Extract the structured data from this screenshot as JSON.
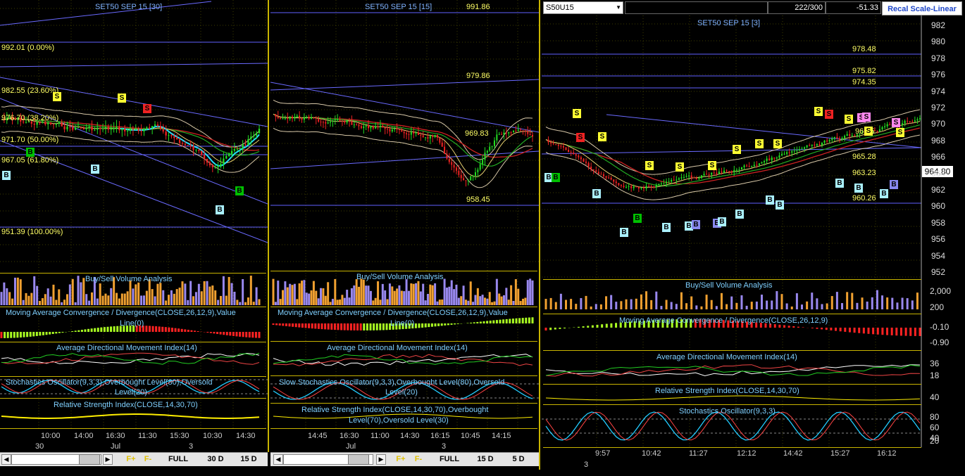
{
  "colors": {
    "bull": "#22dd22",
    "bear": "#ee2222",
    "accent": "#c8b400",
    "fib": "#ffff66",
    "indicator": "#7fd0ff",
    "header_link": "#1e46c8"
  },
  "left": {
    "title": "SET50 SEP 15  [30]",
    "fib_labels": [
      "992.01 (0.00%)",
      "982.55 (23.60%)",
      "976.70 (38.20%)",
      "971.70 (50.00%)",
      "967.05 (61.80%)",
      "951.39 (100.00%)"
    ],
    "indicators": [
      "Buy/Sell Volume Analysis",
      "Moving Average Convergence / Divergence(CLOSE,26,12,9),Value",
      "Line(0)",
      "Average Directional Movement Index(14)",
      "Stochastics Oscillator(9,3,3),Overbought Level(80),Oversold",
      "Level(20)",
      "Relative Strength Index(CLOSE,14,30,70)"
    ],
    "time_ticks": [
      "10:00",
      "14:00",
      "16:30",
      "11:30",
      "15:30",
      "10:30",
      "14:30"
    ],
    "date_ticks": [
      "30",
      "Jul",
      "3"
    ],
    "toolbar": {
      "f_plus": "F+",
      "f_minus": "F-",
      "full": "FULL",
      "d30": "30 D",
      "d15": "15 D"
    },
    "markers": [
      {
        "t": "S",
        "k": "s"
      },
      {
        "t": "S",
        "k": "s"
      },
      {
        "t": "S",
        "k": "sr"
      },
      {
        "t": "B",
        "k": "bg"
      },
      {
        "t": "B",
        "k": "b"
      },
      {
        "t": "B",
        "k": "b"
      },
      {
        "t": "B",
        "k": "bg"
      },
      {
        "t": "B",
        "k": "b"
      }
    ]
  },
  "mid": {
    "title": "SET50 SEP 15  [15]",
    "levels": [
      "991.86",
      "979.86",
      "969.83",
      "958.45"
    ],
    "indicators": [
      "Buy/Sell Volume Analysis",
      "Moving Average Convergence / Divergence(CLOSE,26,12,9),Value",
      "Line(0)",
      "Average Directional Movement Index(14)",
      "Slow Stochastics Oscillator(9,3,3),Overbought Level(80),Oversold",
      "Level(20)",
      "Relative Strength Index(CLOSE,14,30,70),Overbought",
      "Level(70),Oversold Level(30)"
    ],
    "time_ticks": [
      "14:45",
      "16:30",
      "11:00",
      "14:30",
      "16:15",
      "10:45",
      "14:15"
    ],
    "date_ticks": [
      "Jul",
      "3"
    ],
    "toolbar": {
      "f_plus": "F+",
      "f_minus": "F-",
      "full": "FULL",
      "d15": "15 D",
      "d5": "5 D"
    },
    "markers": [
      {
        "t": "S",
        "k": "sp"
      },
      {
        "t": "S",
        "k": "s"
      },
      {
        "t": "S",
        "k": "sr"
      },
      {
        "t": "S",
        "k": "s"
      },
      {
        "t": "S",
        "k": "sp"
      },
      {
        "t": "S",
        "k": "sr"
      },
      {
        "t": "S",
        "k": "s"
      },
      {
        "t": "S",
        "k": "s"
      },
      {
        "t": "S",
        "k": "s"
      },
      {
        "t": "S",
        "k": "s"
      },
      {
        "t": "S",
        "k": "sp"
      },
      {
        "t": "B",
        "k": "bv"
      },
      {
        "t": "B",
        "k": "b"
      },
      {
        "t": "B",
        "k": "bg"
      },
      {
        "t": "B",
        "k": "bv"
      },
      {
        "t": "B",
        "k": "b"
      },
      {
        "t": "B",
        "k": "b"
      },
      {
        "t": "B",
        "k": "b"
      },
      {
        "t": "B",
        "k": "b"
      },
      {
        "t": "B",
        "k": "bg"
      },
      {
        "t": "B",
        "k": "bv"
      }
    ]
  },
  "right": {
    "symbol": "S50U15",
    "count": "222/300",
    "change": "-51.33",
    "recal_label": "Recal Scale-Linear",
    "title": "SET50 SEP 15  [3]",
    "levels": [
      "978.48",
      "975.82",
      "974.35",
      "966.5",
      "965.28",
      "963.23",
      "960.26"
    ],
    "last_price": "964.80",
    "price_axis": [
      "982",
      "980",
      "978",
      "976",
      "974",
      "972",
      "970",
      "968",
      "966",
      "964",
      "962",
      "960",
      "958",
      "956",
      "954",
      "952"
    ],
    "indicators": [
      "Buy/Sell Volume Analysis",
      "Moving Average Convergence / Divergence(CLOSE,26,12,9)",
      "Average Directional Movement Index(14)",
      "Relative Strength Index(CLOSE,14,30,70)",
      "Stochastics Oscillator(9,3,3)"
    ],
    "vol_axis": [
      "2,000",
      "200"
    ],
    "macd_axis": [
      "-0.10",
      "-0.90"
    ],
    "adx_axis": [
      "36",
      "18"
    ],
    "rsi_axis": [
      "40"
    ],
    "sto_axis": [
      "80",
      "60",
      "40",
      "20"
    ],
    "time_ticks": [
      "9:57",
      "10:42",
      "11:27",
      "12:12",
      "14:42",
      "15:27",
      "16:12"
    ],
    "date_ticks": [
      "3"
    ],
    "markers": [
      {
        "t": "S",
        "k": "s"
      },
      {
        "t": "S",
        "k": "sr"
      },
      {
        "t": "S",
        "k": "s"
      },
      {
        "t": "S",
        "k": "s"
      },
      {
        "t": "S",
        "k": "s"
      },
      {
        "t": "S",
        "k": "s"
      },
      {
        "t": "S",
        "k": "s"
      },
      {
        "t": "S",
        "k": "s"
      },
      {
        "t": "S",
        "k": "s"
      },
      {
        "t": "S",
        "k": "s"
      },
      {
        "t": "S",
        "k": "sr"
      },
      {
        "t": "S",
        "k": "s"
      },
      {
        "t": "S",
        "k": "sp"
      },
      {
        "t": "S",
        "k": "sp"
      },
      {
        "t": "S",
        "k": "s"
      },
      {
        "t": "S",
        "k": "sp"
      },
      {
        "t": "S",
        "k": "s"
      },
      {
        "t": "B",
        "k": "b"
      },
      {
        "t": "B",
        "k": "bg"
      },
      {
        "t": "B",
        "k": "b"
      },
      {
        "t": "B",
        "k": "b"
      },
      {
        "t": "B",
        "k": "bg"
      },
      {
        "t": "B",
        "k": "b"
      },
      {
        "t": "B",
        "k": "b"
      },
      {
        "t": "B",
        "k": "bv"
      },
      {
        "t": "B",
        "k": "bv"
      },
      {
        "t": "B",
        "k": "b"
      },
      {
        "t": "B",
        "k": "b"
      },
      {
        "t": "B",
        "k": "b"
      },
      {
        "t": "B",
        "k": "b"
      },
      {
        "t": "B",
        "k": "b"
      },
      {
        "t": "B",
        "k": "b"
      },
      {
        "t": "B",
        "k": "b"
      },
      {
        "t": "B",
        "k": "bv"
      }
    ]
  }
}
